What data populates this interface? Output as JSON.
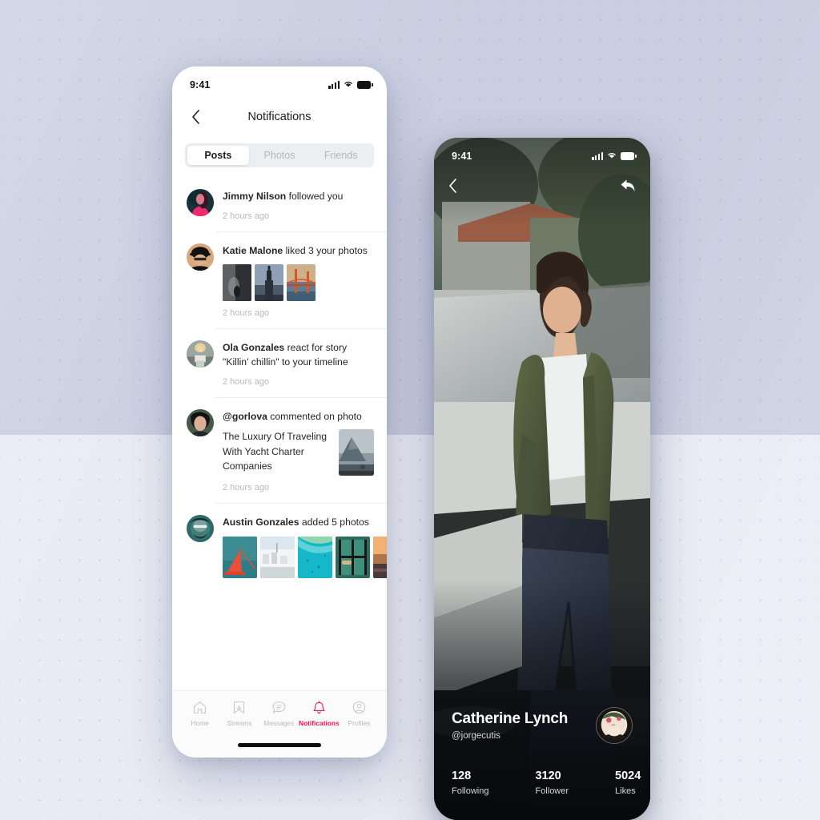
{
  "background": {
    "top_color": "#c9cee0",
    "bottom_color": "#e8ebf4",
    "dot_color": "#7882a5"
  },
  "phone_notifications": {
    "status_bar": {
      "time": "9:41",
      "signal_icon": "cellular-signal-icon",
      "wifi_icon": "wifi-icon",
      "battery_icon": "battery-icon"
    },
    "header": {
      "back_icon": "chevron-left-icon",
      "title": "Notifications"
    },
    "tabs": [
      {
        "label": "Posts",
        "active": true
      },
      {
        "label": "Photos",
        "active": false
      },
      {
        "label": "Friends",
        "active": false
      }
    ],
    "notifications": [
      {
        "actor": "Jimmy Nilson",
        "action": " followed you",
        "time": "2 hours ago",
        "avatar": "avatar-jimmy-nilson",
        "thumbs": []
      },
      {
        "actor": "Katie Malone",
        "action": " liked 3 your photos",
        "time": "2 hours ago",
        "avatar": "avatar-katie-malone",
        "thumbs": [
          "photo-waterfall",
          "photo-tower",
          "photo-golden-gate"
        ]
      },
      {
        "actor": "Ola Gonzales",
        "action": " react for story \"Killin' chillin\" to your timeline",
        "time": "2 hours ago",
        "avatar": "avatar-ola-gonzales",
        "thumbs": []
      },
      {
        "actor": "@gorlova",
        "action": " commented on photo",
        "comment_title": "The Luxury Of Traveling With Yacht Charter Companies",
        "comment_thumb": "photo-mountain-fjord",
        "time": "2 hours ago",
        "avatar": "avatar-gorlova",
        "thumbs": []
      },
      {
        "actor": "Austin Gonzales",
        "action": " added 5 photos",
        "time": "",
        "avatar": "avatar-austin-gonzales",
        "thumbs": [
          "photo-sailboat-sea",
          "photo-white-town",
          "photo-turquoise-coast",
          "photo-green-window",
          "photo-orange-sunset"
        ]
      }
    ],
    "tabbar": {
      "active_color": "#e8174c",
      "items": [
        {
          "label": "Home",
          "icon": "home-icon",
          "active": false
        },
        {
          "label": "Streams",
          "icon": "bookmark-icon",
          "active": false
        },
        {
          "label": "Messages",
          "icon": "chat-bubble-icon",
          "active": false
        },
        {
          "label": "Notifications",
          "icon": "bell-icon",
          "active": true
        },
        {
          "label": "Profiles",
          "icon": "user-circle-icon",
          "active": false
        }
      ]
    },
    "home_indicator": "home-indicator-bar"
  },
  "phone_profile": {
    "status_bar": {
      "time": "9:41",
      "signal_icon": "cellular-signal-icon",
      "wifi_icon": "wifi-icon",
      "battery_icon": "battery-icon"
    },
    "header": {
      "back_icon": "chevron-left-icon",
      "share_icon": "reply-share-icon"
    },
    "profile": {
      "name": "Catherine Lynch",
      "handle": "@jorgecutis",
      "avatar": "avatar-catherine-lynch",
      "stats": [
        {
          "value": "128",
          "label": "Following"
        },
        {
          "value": "3120",
          "label": "Follower"
        },
        {
          "value": "5024",
          "label": "Likes"
        }
      ]
    }
  }
}
